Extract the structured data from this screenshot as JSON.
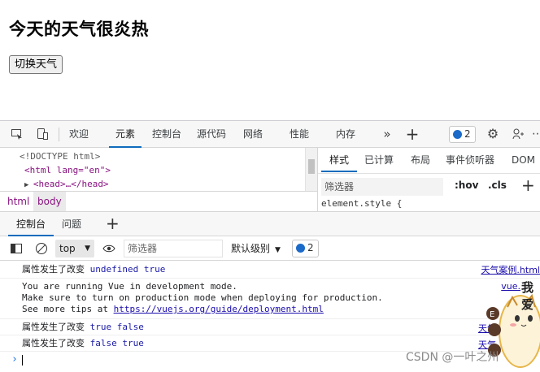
{
  "page": {
    "heading": "今天的天气很炎热",
    "toggle_button": "切换天气"
  },
  "devtools": {
    "main_tabs": [
      "欢迎",
      "元素",
      "控制台",
      "源代码",
      "网络",
      "性能",
      "内存"
    ],
    "active_main_tab": "元素",
    "issues_count": "2",
    "elements_lines": [
      "<!DOCTYPE html>",
      "<html lang=\"en\">",
      "<head>…</head>"
    ],
    "breadcrumbs": [
      "html",
      "body"
    ],
    "styles_tabs": [
      "样式",
      "已计算",
      "布局",
      "事件侦听器",
      "DOM 断"
    ],
    "styles_filter_placeholder": "筛选器",
    "hov_label": ":hov",
    "cls_label": ".cls",
    "element_style": "element.style {"
  },
  "drawer": {
    "tabs": [
      "控制台",
      "问题"
    ],
    "context": "top",
    "filter_placeholder": "筛选器",
    "log_level": "默认级别",
    "issues_count": "2"
  },
  "console": {
    "messages": [
      {
        "prefix": "属性发生了改变",
        "rest": " undefined true",
        "source": "天气案例.html"
      },
      {
        "line1": "You are running Vue in development mode.",
        "line2": "Make sure to turn on production mode when deploying for production.",
        "line3_prefix": "See more tips at ",
        "line3_link": "https://vuejs.org/guide/deployment.html",
        "source": "vue."
      },
      {
        "prefix": "属性发生了改变",
        "rest": " true false",
        "source": "天气"
      },
      {
        "prefix": "属性发生了改变",
        "rest": " false true",
        "source": "天气"
      }
    ],
    "prompt": "›"
  },
  "overlay": {
    "watermark": "CSDN @一叶之州",
    "sticker_text": "我爱"
  },
  "colors": {
    "accent": "#0f6cbd",
    "link": "#1a0dab",
    "tag": "#881280"
  }
}
